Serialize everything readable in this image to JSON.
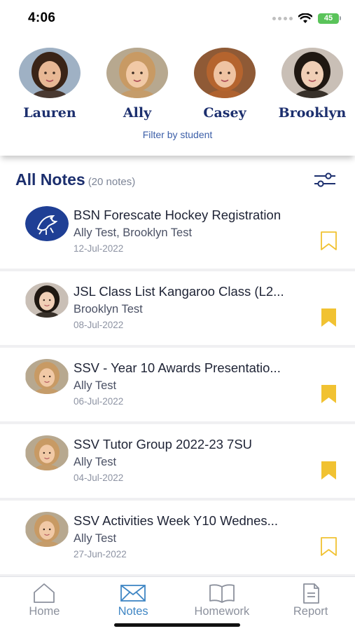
{
  "status_bar": {
    "time": "4:06",
    "battery": "45"
  },
  "students": [
    {
      "name": "Lauren",
      "hair": "#3a2417",
      "skin": "#e8b895",
      "bg": "#9fb1c4"
    },
    {
      "name": "Ally",
      "hair": "#c89a64",
      "skin": "#f1c9a6",
      "bg": "#b7a88f"
    },
    {
      "name": "Casey",
      "hair": "#b5642e",
      "skin": "#efc3a2",
      "bg": "#8f5a36"
    },
    {
      "name": "Brooklyn",
      "hair": "#1f1812",
      "skin": "#f0cfb6",
      "bg": "#c9bfb6"
    }
  ],
  "filter_label": "Filter by student",
  "notes_header": {
    "title": "All Notes",
    "count": "(20 notes)"
  },
  "notes": [
    {
      "title": "BSN Forescate Hockey Registration",
      "students": "Ally Test, Brooklyn Test",
      "date": "12-Jul-2022",
      "bookmarked": false,
      "avatar": "logo"
    },
    {
      "title": "JSL Class List Kangaroo Class (L2...",
      "students": "Brooklyn Test",
      "date": "08-Jul-2022",
      "bookmarked": true,
      "avatar": "brooklyn"
    },
    {
      "title": "SSV - Year 10 Awards Presentatio...",
      "students": "Ally Test",
      "date": "06-Jul-2022",
      "bookmarked": true,
      "avatar": "ally"
    },
    {
      "title": "SSV Tutor Group 2022-23 7SU",
      "students": "Ally Test",
      "date": "04-Jul-2022",
      "bookmarked": true,
      "avatar": "ally"
    },
    {
      "title": "SSV Activities Week Y10 Wednes...",
      "students": "Ally Test",
      "date": "27-Jun-2022",
      "bookmarked": false,
      "avatar": "ally"
    }
  ],
  "tabs": [
    {
      "label": "Home",
      "icon": "home-icon",
      "active": false
    },
    {
      "label": "Notes",
      "icon": "envelope-icon",
      "active": true
    },
    {
      "label": "Homework",
      "icon": "book-icon",
      "active": false
    },
    {
      "label": "Report",
      "icon": "document-icon",
      "active": false
    }
  ],
  "colors": {
    "brand_navy": "#1c2f6e",
    "accent_blue": "#3f86c4",
    "bookmark_gold": "#f1c232",
    "logo_blue": "#1f3f95"
  }
}
